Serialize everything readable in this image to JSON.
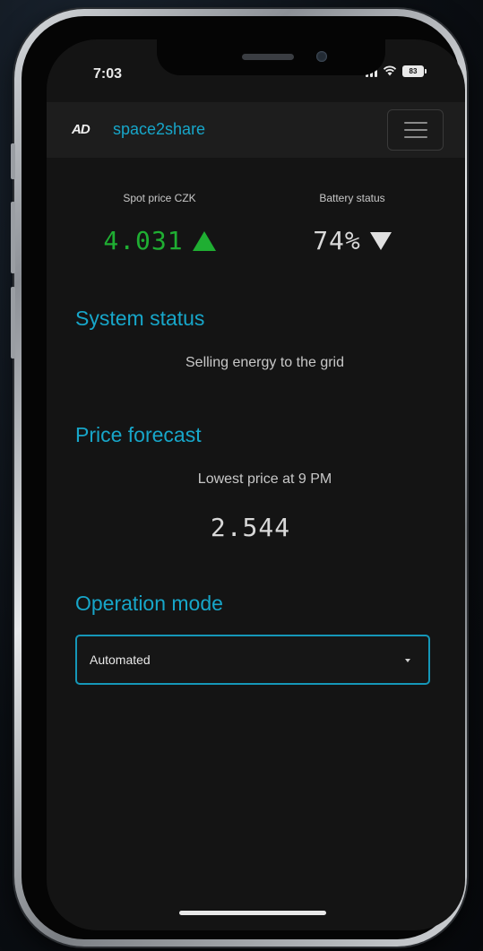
{
  "status_bar": {
    "time": "7:03",
    "battery_level": "83"
  },
  "navbar": {
    "logo_text": "AD",
    "brand": "space2share",
    "menu_icon": "hamburger-icon"
  },
  "stats": {
    "spot_price_label": "Spot price CZK",
    "spot_price_value": "4.031",
    "spot_trend_icon": "triangle-up-icon",
    "battery_label": "Battery status",
    "battery_value": "74%",
    "battery_trend_icon": "triangle-down-icon"
  },
  "system_status": {
    "title": "System status",
    "text": "Selling energy to the grid"
  },
  "price_forecast": {
    "title": "Price forecast",
    "text": "Lowest price at 9 PM",
    "value": "2.544"
  },
  "operation_mode": {
    "title": "Operation mode",
    "selected": "Automated"
  },
  "colors": {
    "accent": "#17a6c9",
    "positive": "#1fae32",
    "background": "#141414",
    "navbar": "#1d1d1d"
  }
}
